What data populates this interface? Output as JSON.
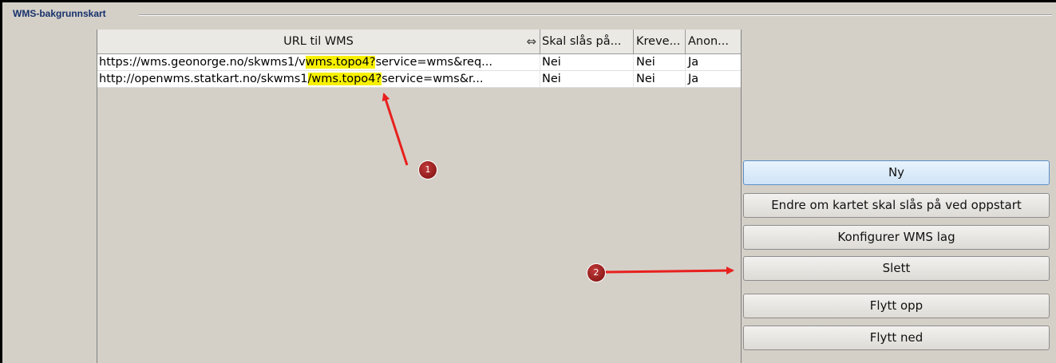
{
  "group": {
    "title": "WMS-bakgrunnskart"
  },
  "table": {
    "columns": [
      "URL til WMS",
      "Skal slås på...",
      "Kreve...",
      "Anon..."
    ],
    "rows": [
      {
        "url_pre": "https://wms.geonorge.no/skwms1/v",
        "url_hl": "wms.topo4?",
        "url_post": "service=wms&req...",
        "skal": "Nei",
        "kreve": "Nei",
        "anon": "Ja"
      },
      {
        "url_pre": "http://openwms.statkart.no/skwms1",
        "url_hl": "/wms.topo4?",
        "url_post": "service=wms&r...",
        "skal": "Nei",
        "kreve": "Nei",
        "anon": "Ja"
      }
    ]
  },
  "buttons": {
    "ny": "Ny",
    "endre": "Endre om kartet skal slås på ved oppstart",
    "konfigurer": "Konfigurer WMS lag",
    "slett": "Slett",
    "flytt_opp": "Flytt opp",
    "flytt_ned": "Flytt ned"
  },
  "annotations": {
    "marker1": "1",
    "marker2": "2",
    "color": "#e8201e"
  }
}
